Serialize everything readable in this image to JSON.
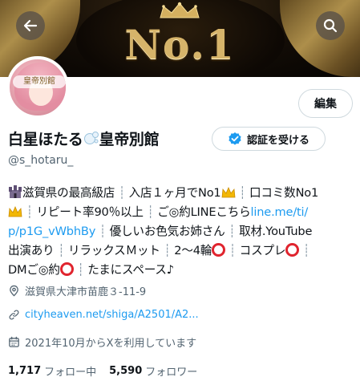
{
  "header": {
    "banner_text": "No.1"
  },
  "avatar": {
    "badge_text": "皇帝別館"
  },
  "actions": {
    "edit_label": "編集",
    "verify_label": "認証を受ける"
  },
  "profile": {
    "display_name_part1": "白星ほたる",
    "display_name_part2": "皇帝別館",
    "handle": "@s_hotaru_"
  },
  "bio": {
    "l1": "滋賀県の最高級店",
    "l1b": "入店１ヶ月でNo1",
    "l1c": "口コミ数No1",
    "l2a": "リピート率90％以上",
    "l2b": "ご◎約LINEこちら",
    "l2link": "line.me/ti/",
    "l3link": "p/p1G_vWbhBy",
    "l3b": "優しいお色気お姉さん",
    "l3c": "取材.YouTube",
    "l4a": "出演あり",
    "l4b": "リラックスＭット",
    "l4c": "2～4輪",
    "l4d": "コスプレ",
    "l5a": "DMご◎約",
    "l5b": "たまにスペース♪"
  },
  "meta": {
    "location": "滋賀県大津市苗鹿３-11-9",
    "url": "cityheaven.net/shiga/A2501/A2...",
    "joined": "2021年10月からXを利用しています"
  },
  "stats": {
    "following_count": "1,717",
    "following_label": "フォロー中",
    "followers_count": "5,590",
    "followers_label": "フォロワー"
  },
  "colors": {
    "link": "#1d9bf0",
    "muted": "#536471",
    "verified": "#1d9bf0",
    "banner_gold": "#d6b46a"
  },
  "icons": [
    "back-arrow-icon",
    "search-icon",
    "verified-badge-icon",
    "location-icon",
    "link-icon",
    "calendar-icon",
    "crown-emoji-icon",
    "castle-emoji-icon",
    "red-circle-emoji-icon",
    "bubbles-emoji-icon"
  ]
}
